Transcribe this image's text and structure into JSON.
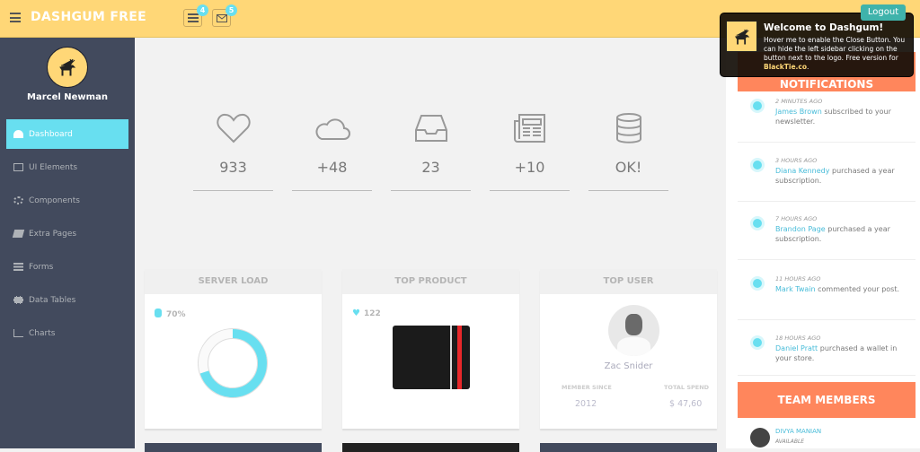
{
  "header": {
    "logo": "DASHGUM FREE",
    "tasks_badge": "4",
    "mail_badge": "5",
    "logout": "Logout"
  },
  "sidebar": {
    "user": "Marcel Newman",
    "items": [
      {
        "label": "Dashboard",
        "icon": "dashboard-icon",
        "active": true
      },
      {
        "label": "UI Elements",
        "icon": "desktop-icon"
      },
      {
        "label": "Components",
        "icon": "cogs-icon"
      },
      {
        "label": "Extra Pages",
        "icon": "book-icon"
      },
      {
        "label": "Forms",
        "icon": "tasks-icon"
      },
      {
        "label": "Data Tables",
        "icon": "table-icon"
      },
      {
        "label": "Charts",
        "icon": "chart-icon"
      }
    ]
  },
  "stats": [
    {
      "icon": "heart-icon",
      "value": "933"
    },
    {
      "icon": "cloud-icon",
      "value": "+48"
    },
    {
      "icon": "inbox-icon",
      "value": "23"
    },
    {
      "icon": "newspaper-icon",
      "value": "+10"
    },
    {
      "icon": "database-icon",
      "value": "OK!"
    }
  ],
  "cards": {
    "server": {
      "title": "SERVER LOAD",
      "value": "70%",
      "percent": 70
    },
    "product": {
      "title": "TOP PRODUCT",
      "likes": "122"
    },
    "user": {
      "title": "TOP USER",
      "name": "Zac Snider",
      "since_label": "MEMBER SINCE",
      "since": "2012",
      "spend_label": "TOTAL SPEND",
      "spend": "$ 47,60"
    }
  },
  "notifications": {
    "title": "NOTIFICATIONS",
    "items": [
      {
        "time": "2 MINUTES AGO",
        "who": "James Brown",
        "text": " subscribed to your newsletter."
      },
      {
        "time": "3 HOURS AGO",
        "who": "Diana Kennedy",
        "text": " purchased a year subscription."
      },
      {
        "time": "7 HOURS AGO",
        "who": "Brandon Page",
        "text": " purchased a year subscription."
      },
      {
        "time": "11 HOURS AGO",
        "who": "Mark Twain",
        "text": " commented your post."
      },
      {
        "time": "18 HOURS AGO",
        "who": "Daniel Pratt",
        "text": " purchased a wallet in your store."
      }
    ]
  },
  "team": {
    "title": "TEAM MEMBERS",
    "members": [
      {
        "name": "DIVYA MANIAN",
        "status": "AVAILABLE"
      }
    ]
  },
  "popup": {
    "title": "Welcome to Dashgum!",
    "text": "Hover me to enable the Close Button. You can hide the left sidebar clicking on the button next to the logo. Free version for ",
    "link": "BlackTie.co",
    "end": "."
  },
  "colors": {
    "header": "#ffd777",
    "sidebar": "#424a5d",
    "accent": "#68dff0",
    "orange": "#ff865c"
  }
}
